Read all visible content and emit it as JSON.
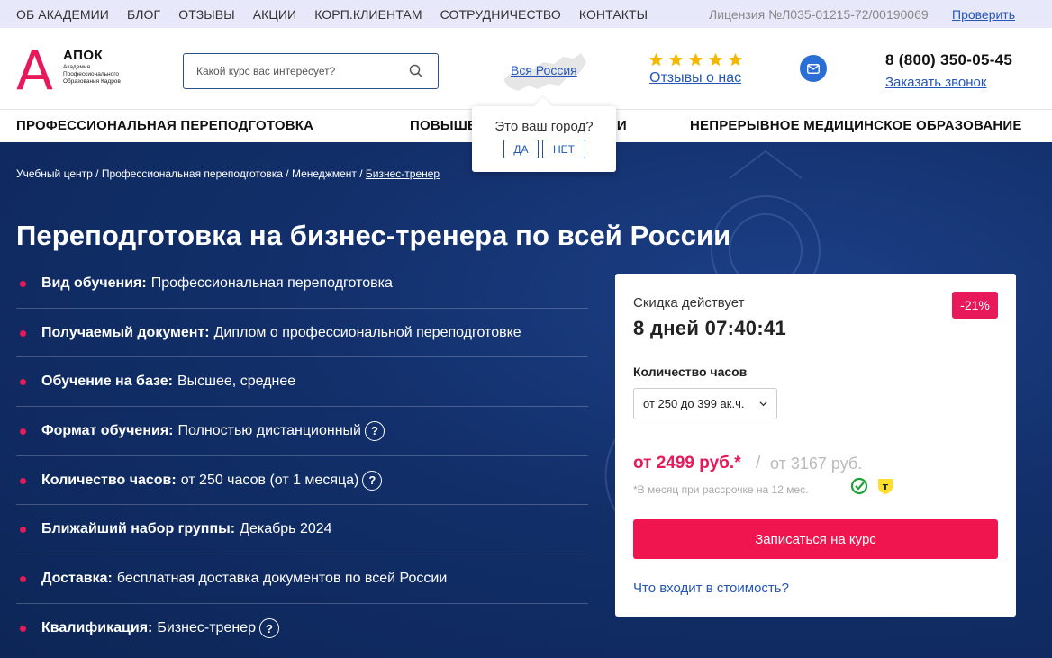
{
  "topbar": {
    "nav": [
      "ОБ АКАДЕМИИ",
      "БЛОГ",
      "ОТЗЫВЫ",
      "АКЦИИ",
      "КОРП.КЛИЕНТАМ",
      "СОТРУДНИЧЕСТВО",
      "КОНТАКТЫ"
    ],
    "license": "Лицензия №Л035-01215-72/00190069",
    "verify": "Проверить"
  },
  "logo": {
    "letter": "А",
    "title": "АПОК",
    "subtitle": "Академия Профессионального Образования Кадров"
  },
  "search": {
    "placeholder": "Какой курс вас интересует?"
  },
  "region": {
    "label": "Вся Россия"
  },
  "reviews": {
    "label": "Отзывы о нас",
    "stars": 5,
    "star_color": "#f5b800"
  },
  "contact": {
    "phone": "8 (800) 350-05-45",
    "callback": "Заказать звонок"
  },
  "mainnav": {
    "items": [
      "ПРОФЕССИОНАЛЬНАЯ ПЕРЕПОДГОТОВКА",
      "ПОВЫШЕНИЕ КВАЛИФИКАЦИИ",
      "НЕПРЕРЫВНОЕ МЕДИЦИНСКОЕ ОБРАЗОВАНИЕ"
    ]
  },
  "city_popup": {
    "question": "Это ваш город?",
    "yes": "ДА",
    "no": "НЕТ"
  },
  "breadcrumb": {
    "items": [
      "Учебный центр",
      "Профессиональная переподготовка",
      "Менеджмент"
    ],
    "current": "Бизнес-тренер",
    "separator": "/"
  },
  "page_title": "Переподготовка на бизнес-тренера по всей России",
  "props": [
    {
      "label": "Вид обучения:",
      "value": "Профессиональная переподготовка"
    },
    {
      "label": "Получаемый документ:",
      "value": "Диплом о профессиональной переподготовке"
    },
    {
      "label": "Обучение на базе:",
      "value": "Высшее, среднее"
    },
    {
      "label": "Формат обучения:",
      "value": "Полностью дистанционный"
    },
    {
      "label": "Количество часов:",
      "value": "от 250 часов (от 1 месяца)"
    },
    {
      "label": "Ближайший набор группы:",
      "value": "Декабрь 2024"
    },
    {
      "label": "Доставка:",
      "value": "бесплатная доставка документов по всей России"
    },
    {
      "label": "Квалификация:",
      "value": "Бизнес-тренер"
    }
  ],
  "help_glyph": "?",
  "card": {
    "discount_label": "Скидка действует",
    "timer": "8 дней 07:40:41",
    "badge": "-21%",
    "hours_label": "Количество часов",
    "hours_selected": "от 250 до 399 ак.ч.",
    "price": "от 2499 руб.*",
    "slash": "/",
    "old_price": "от 3167 руб.",
    "installment_note": "*В месяц при рассрочке на 12 мес.",
    "pay_icon_letter": "т",
    "enroll": "Записаться на курс",
    "included": "Что входит в стоимость?"
  },
  "colors": {
    "accent": "#e8195a",
    "link": "#2356b6",
    "hero": "#122f6a"
  }
}
